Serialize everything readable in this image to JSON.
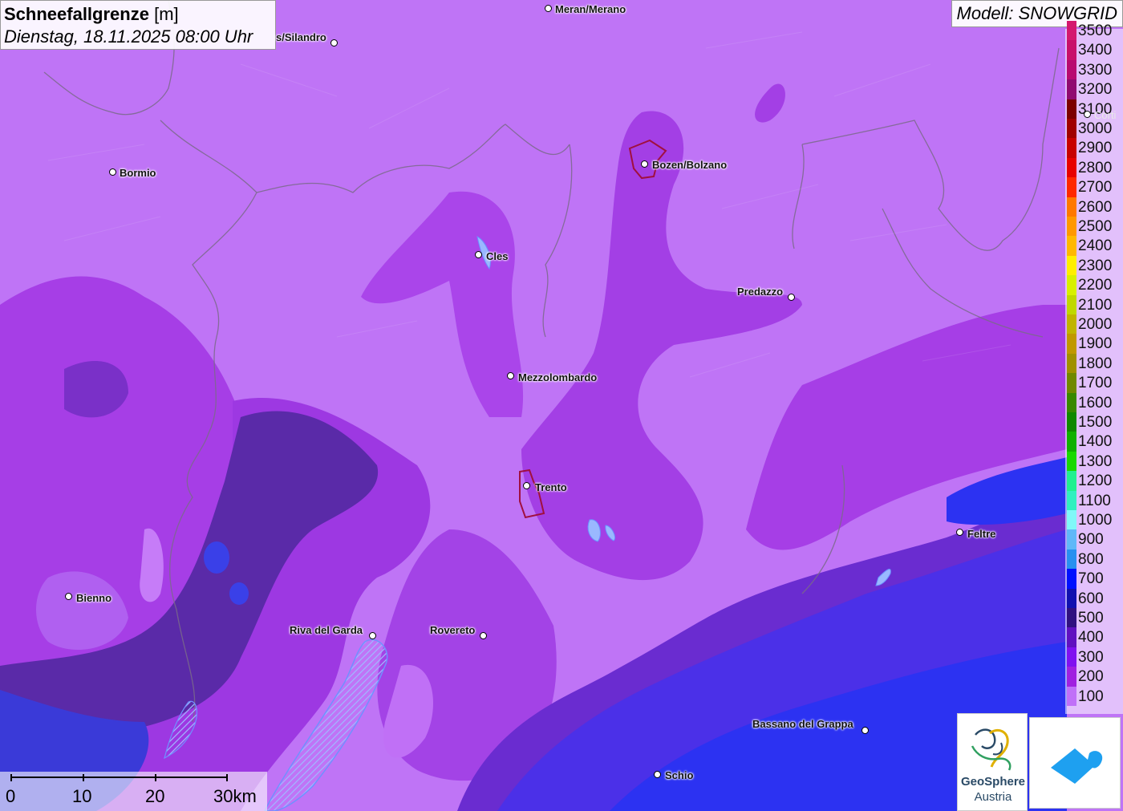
{
  "header": {
    "title_bold": "Schneefallgrenze",
    "title_unit": "[m]",
    "datetime": "Dienstag, 18.11.2025 08:00 Uhr"
  },
  "model_label": "Modell: SNOWGRID",
  "legend": {
    "entries": [
      {
        "label": "3500",
        "color": "#d4186e"
      },
      {
        "label": "3400",
        "color": "#c8106a"
      },
      {
        "label": "3300",
        "color": "#b80a70"
      },
      {
        "label": "3200",
        "color": "#900a70"
      },
      {
        "label": "3100",
        "color": "#7c0000"
      },
      {
        "label": "3000",
        "color": "#a00000"
      },
      {
        "label": "2900",
        "color": "#c80000"
      },
      {
        "label": "2800",
        "color": "#e80000"
      },
      {
        "label": "2700",
        "color": "#ff2800"
      },
      {
        "label": "2600",
        "color": "#ff7800"
      },
      {
        "label": "2500",
        "color": "#ff9800"
      },
      {
        "label": "2400",
        "color": "#ffb800"
      },
      {
        "label": "2300",
        "color": "#ffee00"
      },
      {
        "label": "2200",
        "color": "#d8f000"
      },
      {
        "label": "2100",
        "color": "#c0d800"
      },
      {
        "label": "2000",
        "color": "#c0b400"
      },
      {
        "label": "1900",
        "color": "#c09800"
      },
      {
        "label": "1800",
        "color": "#a09000"
      },
      {
        "label": "1700",
        "color": "#708800"
      },
      {
        "label": "1600",
        "color": "#388800"
      },
      {
        "label": "1500",
        "color": "#108800"
      },
      {
        "label": "1400",
        "color": "#10b000"
      },
      {
        "label": "1300",
        "color": "#18d800"
      },
      {
        "label": "1200",
        "color": "#20f090"
      },
      {
        "label": "1100",
        "color": "#30f0c0"
      },
      {
        "label": "1000",
        "color": "#80f8f8"
      },
      {
        "label": "900",
        "color": "#60b8f8"
      },
      {
        "label": "800",
        "color": "#2890f0"
      },
      {
        "label": "700",
        "color": "#0010ff"
      },
      {
        "label": "600",
        "color": "#1010b0"
      },
      {
        "label": "500",
        "color": "#301080"
      },
      {
        "label": "400",
        "color": "#6010c0"
      },
      {
        "label": "300",
        "color": "#8010f0"
      },
      {
        "label": "200",
        "color": "#a020e0"
      },
      {
        "label": "100",
        "color": "#c070f8"
      }
    ]
  },
  "places": [
    {
      "name": "Meran/Merano"
    },
    {
      "name": "s/Silandro"
    },
    {
      "name": "Bormio"
    },
    {
      "name": "Bozen/Bolzano"
    },
    {
      "name": "Cles"
    },
    {
      "name": "Predazzo"
    },
    {
      "name": "Mezzolombardo"
    },
    {
      "name": "Trento"
    },
    {
      "name": "Feltre"
    },
    {
      "name": "Bienno"
    },
    {
      "name": "Riva del Garda"
    },
    {
      "name": "Rovereto"
    },
    {
      "name": "Bassano del Grappa"
    },
    {
      "name": "Schio"
    },
    {
      "name": "Corti"
    }
  ],
  "scalebar": {
    "labels": [
      "0",
      "10",
      "20",
      "30km"
    ]
  },
  "logos": {
    "geosphere_line1": "GeoSphere",
    "geosphere_line2": "Austria"
  }
}
